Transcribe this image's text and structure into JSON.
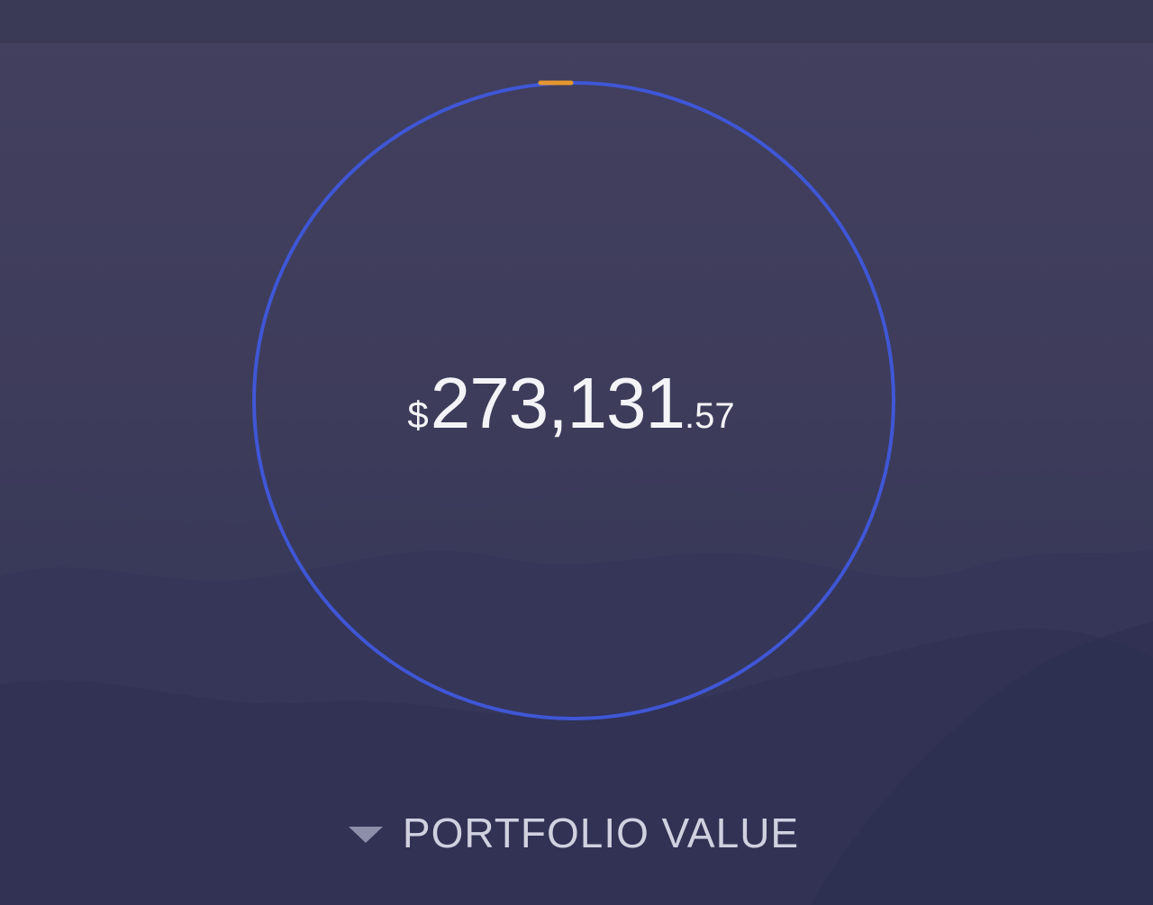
{
  "portfolio": {
    "currency_symbol": "$",
    "value_main": "273,131",
    "value_cents": ".57",
    "label": "PORTFOLIO VALUE"
  },
  "icons": {
    "label_toggle": "caret-down-icon"
  },
  "colors": {
    "ring": "#3f57d6",
    "marker": "#e6962f",
    "background": "#3d3c5a",
    "text": "#f4f4f8",
    "label": "#d0d1df"
  }
}
